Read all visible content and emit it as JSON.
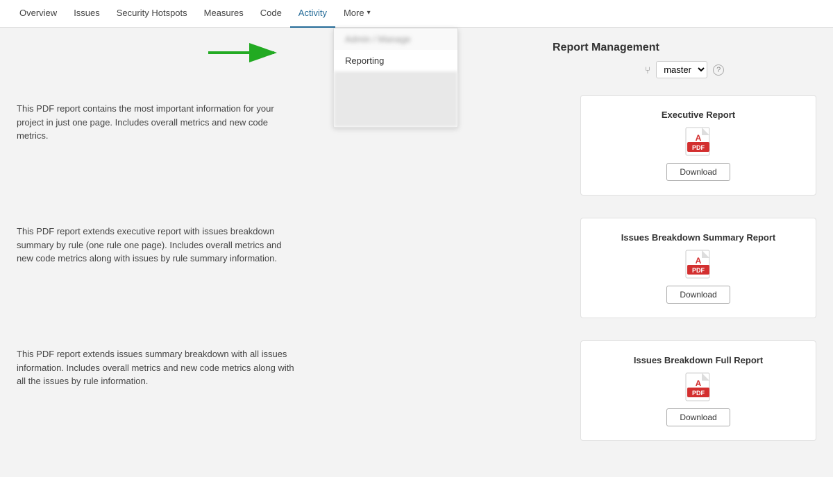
{
  "nav": {
    "items": [
      {
        "label": "Overview",
        "active": false
      },
      {
        "label": "Issues",
        "active": false
      },
      {
        "label": "Security Hotspots",
        "active": false
      },
      {
        "label": "Measures",
        "active": false
      },
      {
        "label": "Code",
        "active": false
      },
      {
        "label": "Activity",
        "active": true
      },
      {
        "label": "More",
        "active": false,
        "hasChevron": true
      }
    ]
  },
  "dropdown": {
    "item1_blurred": "Admin / Manage",
    "item2": "Reporting"
  },
  "page": {
    "title": "Report Management",
    "branch_label": "master",
    "help_label": "?"
  },
  "reports": [
    {
      "title": "Executive Report",
      "description": "This PDF report contains the most important information for your project in just one page. Includes overall metrics and new code metrics.",
      "download_label": "Download"
    },
    {
      "title": "Issues Breakdown Summary Report",
      "description": "This PDF report extends executive report with issues breakdown summary by rule (one rule one page). Includes overall metrics and new code metrics along with issues by rule summary information.",
      "download_label": "Download"
    },
    {
      "title": "Issues Breakdown Full Report",
      "description": "This PDF report extends issues summary breakdown with all issues information. Includes overall metrics and new code metrics along with all the issues by rule information.",
      "download_label": "Download"
    }
  ],
  "icons": {
    "pdf": "PDF",
    "branch": "⑂",
    "chevron": "▾"
  }
}
